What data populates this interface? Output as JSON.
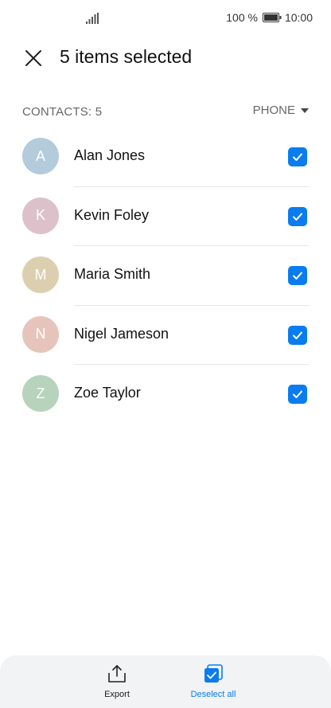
{
  "status_bar": {
    "battery_percent": "100 %",
    "time": "10:00",
    "signal_icon": "signal-bars-icon",
    "battery_icon": "battery-full-icon"
  },
  "header": {
    "title": "5 items selected",
    "close_icon": "close-icon"
  },
  "list_header": {
    "count_label": "CONTACTS: 5",
    "source_label": "PHONE"
  },
  "contacts": [
    {
      "initial": "A",
      "name": "Alan Jones",
      "color": "#b3cbdb",
      "checked": true
    },
    {
      "initial": "K",
      "name": "Kevin Foley",
      "color": "#dcc1ca",
      "checked": true
    },
    {
      "initial": "M",
      "name": "Maria Smith",
      "color": "#dccfb0",
      "checked": true
    },
    {
      "initial": "N",
      "name": "Nigel Jameson",
      "color": "#e6c4bc",
      "checked": true
    },
    {
      "initial": "Z",
      "name": "Zoe Taylor",
      "color": "#b7d3bb",
      "checked": true
    }
  ],
  "bottom_bar": {
    "export_label": "Export",
    "deselect_label": "Deselect all"
  },
  "colors": {
    "accent": "#0a7cf0",
    "bottom_bar_bg": "#f1f3f5"
  }
}
